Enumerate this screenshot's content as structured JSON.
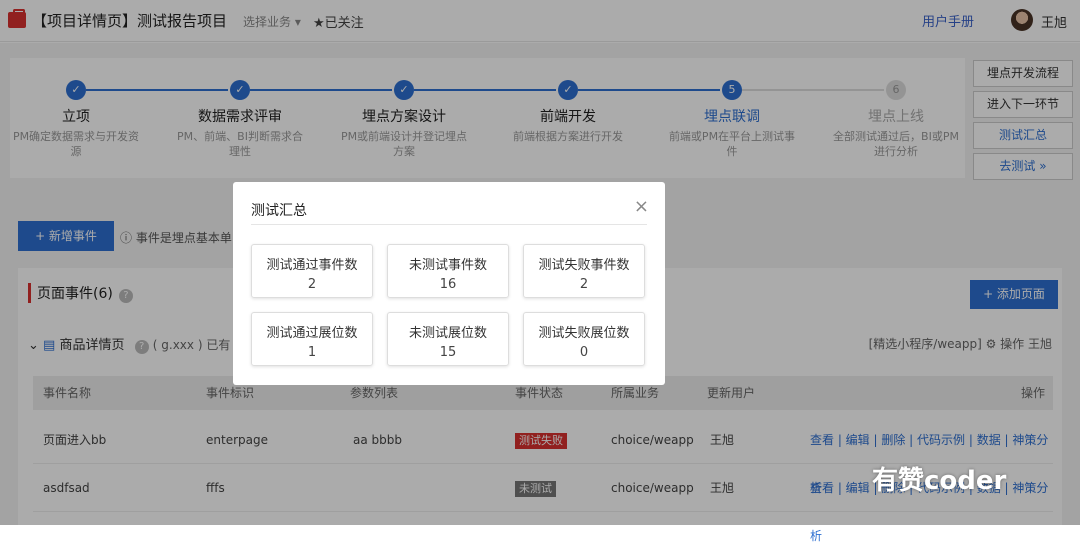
{
  "header": {
    "title": "【项目详情页】测试报告项目",
    "business": "选择业务 ▾",
    "follow": "★已关注",
    "manual": "用户手册",
    "user": "王旭"
  },
  "steps": [
    {
      "num": "✓",
      "name": "立项",
      "desc": "PM确定数据需求与开发资源"
    },
    {
      "num": "✓",
      "name": "数据需求评审",
      "desc": "PM、前端、BI判断需求合理性"
    },
    {
      "num": "✓",
      "name": "埋点方案设计",
      "desc": "PM或前端设计并登记埋点方案"
    },
    {
      "num": "✓",
      "name": "前端开发",
      "desc": "前端根据方案进行开发"
    },
    {
      "num": "5",
      "name": "埋点联调",
      "desc": "前端或PM在平台上测试事件"
    },
    {
      "num": "6",
      "name": "埋点上线",
      "desc": "全部测试通过后，BI或PM进行分析"
    }
  ],
  "side_buttons": [
    "埋点开发流程",
    "进入下一环节",
    "测试汇总",
    "去测试 »"
  ],
  "toolbar": {
    "add_event": "+ 新增事件",
    "tip": "ⓘ 事件是埋点基本单"
  },
  "section": {
    "title": "页面事件(6)",
    "add_page": "+ 添加页面",
    "page_name": "商品详情页",
    "page_code": "( g.xxx ) 已有 2",
    "page_meta": "[精选小程序/weapp]  ⚙ 操作   王旭"
  },
  "table": {
    "headers": [
      "事件名称",
      "事件标识",
      "参数列表",
      "事件状态",
      "所属业务",
      "更新用户",
      "操作"
    ],
    "rows": [
      {
        "name": "页面进入bb",
        "id": "enterpage",
        "params": "aa bbbb",
        "status": "测试失败",
        "biz": "choice/weapp",
        "user": "王旭",
        "ops": "查看 | 编辑 | 删除 | 代码示例 | 数据 | 神策分析"
      },
      {
        "name": "asdfsad",
        "id": "fffs",
        "params": "",
        "status": "未测试",
        "biz": "choice/weapp",
        "user": "王旭",
        "ops": "查看 | 编辑 | 删除 | 代码示例 | 数据 | 神策分析"
      }
    ]
  },
  "modal": {
    "title": "测试汇总",
    "close": "×",
    "stats": [
      {
        "label": "测试通过事件数",
        "value": "2"
      },
      {
        "label": "未测试事件数",
        "value": "16"
      },
      {
        "label": "测试失败事件数",
        "value": "2"
      },
      {
        "label": "测试通过展位数",
        "value": "1"
      },
      {
        "label": "未测试展位数",
        "value": "15"
      },
      {
        "label": "测试失败展位数",
        "value": "0"
      }
    ]
  },
  "watermark": "有赞coder",
  "colors": {
    "accent": "#2d6fd1",
    "danger": "#d9302f",
    "muted": "#999999"
  }
}
